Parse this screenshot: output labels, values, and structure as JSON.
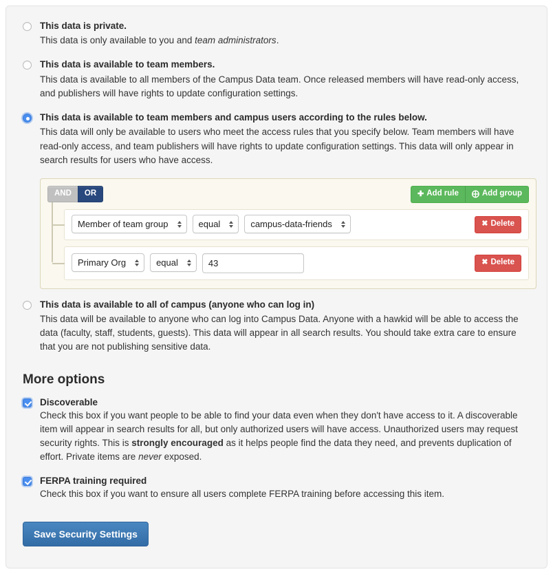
{
  "options": [
    {
      "id": "private",
      "selected": false,
      "title": "This data is private.",
      "desc_pre": "This data is only available to you and ",
      "desc_em": "team administrators",
      "desc_post": "."
    },
    {
      "id": "team-members",
      "selected": false,
      "title": "This data is available to team members.",
      "desc": "This data is available to all members of the Campus Data team. Once released members will have read-only access, and publishers will have rights to update configuration settings."
    },
    {
      "id": "rules",
      "selected": true,
      "title": "This data is available to team members and campus users according to the rules below.",
      "desc": "This data will only be available to users who meet the access rules that you specify below. Team members will have read-only access, and team publishers will have rights to update configuration settings. This data will only appear in search results for users who have access."
    },
    {
      "id": "all-campus",
      "selected": false,
      "title": "This data is available to all of campus (anyone who can log in)",
      "desc": "This data will be available to anyone who can log into Campus Data. Anyone with a hawkid will be able to access the data (faculty, staff, students, guests). This data will appear in all search results. You should take extra care to ensure that you are not publishing sensitive data."
    }
  ],
  "query_builder": {
    "condition": {
      "and_label": "AND",
      "or_label": "OR",
      "selected": "OR"
    },
    "add_rule_label": "Add rule",
    "add_rule_icon": "plus-icon",
    "add_group_label": "Add group",
    "add_group_icon": "plus-circle-icon",
    "delete_label": "Delete",
    "delete_icon": "x-icon",
    "rules": [
      {
        "field": "Member of team group",
        "operator": "equal",
        "value": "campus-data-friends",
        "value_type": "select"
      },
      {
        "field": "Primary Org",
        "operator": "equal",
        "value": "43",
        "value_type": "text"
      }
    ]
  },
  "more_options": {
    "heading": "More options",
    "checkboxes": [
      {
        "id": "discoverable",
        "checked": true,
        "label": "Discoverable",
        "desc_1": "Check this box if you want people to be able to find your data even when they don't have access to it. A discoverable item will appear in search results for all, but only authorized users will have access. Unauthorized users may request security rights. This is ",
        "desc_strong": "strongly encouraged",
        "desc_2": " as it helps people find the data they need, and prevents duplication of effort. Private items are ",
        "desc_em": "never",
        "desc_3": " exposed."
      },
      {
        "id": "ferpa",
        "checked": true,
        "label": "FERPA training required",
        "desc_1": "Check this box if you want to ensure all users complete FERPA training before accessing this item.",
        "desc_strong": "",
        "desc_2": "",
        "desc_em": "",
        "desc_3": ""
      }
    ],
    "save_button_label": "Save Security Settings"
  },
  "colors": {
    "accent_blue": "#4a8ef0",
    "save_blue": "#3c7cb8",
    "green": "#5cb85c",
    "red": "#d9534f",
    "or_navy": "#29487d",
    "panel_cream": "#faf8ef"
  }
}
